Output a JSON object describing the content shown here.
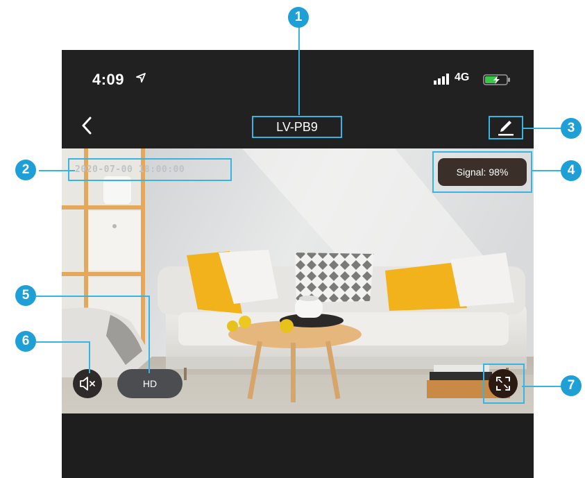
{
  "status_bar": {
    "time": "4:09",
    "network": "4G",
    "icons": [
      "location-arrow-icon",
      "cellular-signal-icon",
      "battery-charging-icon"
    ]
  },
  "nav": {
    "title": "LV-PB9",
    "icons": [
      "back-chevron-icon",
      "edit-pencil-icon"
    ]
  },
  "video": {
    "timestamp": "2020-07-00 18:00:00",
    "signal_text": "Signal: 98%",
    "quality_label": "HD",
    "icons": [
      "speaker-mute-icon",
      "fullscreen-icon"
    ]
  },
  "callouts": [
    "1",
    "2",
    "3",
    "4",
    "5",
    "6",
    "7"
  ],
  "colors": {
    "highlight": "#35b5e0",
    "callout": "#1ea0d6",
    "app_background": "#212121",
    "cushion_yellow": "#f1b21b"
  }
}
